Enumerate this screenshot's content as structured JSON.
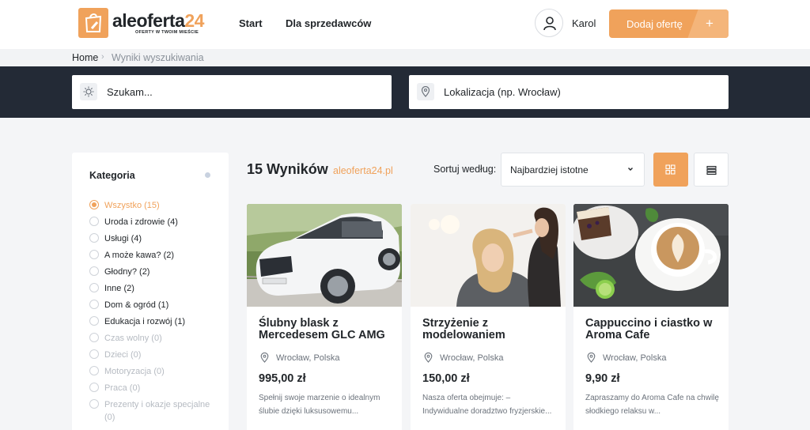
{
  "header": {
    "logo_text": "aleoferta",
    "logo_number": "24",
    "logo_tagline": "OFERTY W TWOIM MIEŚCIE",
    "nav": [
      "Start",
      "Dla sprzedawców"
    ],
    "user_name": "Karol",
    "add_button": "Dodaj ofertę",
    "add_icon": "+",
    "accent_color": "#f0a25b"
  },
  "breadcrumb": {
    "home": "Home",
    "separator": "›",
    "current": "Wyniki wyszukiwania"
  },
  "search": {
    "query_placeholder": "Szukam...",
    "location_placeholder": "Lokalizacja (np. Wrocław)"
  },
  "sidebar": {
    "title": "Kategoria",
    "categories": [
      {
        "label": "Wszystko (15)",
        "state": "active"
      },
      {
        "label": "Uroda i zdrowie (4)",
        "state": "normal"
      },
      {
        "label": "Usługi (4)",
        "state": "normal"
      },
      {
        "label": "A może kawa? (2)",
        "state": "normal"
      },
      {
        "label": "Głodny? (2)",
        "state": "normal"
      },
      {
        "label": "Inne (2)",
        "state": "normal"
      },
      {
        "label": "Dom & ogród (1)",
        "state": "normal"
      },
      {
        "label": "Edukacja i rozwój (1)",
        "state": "normal"
      },
      {
        "label": "Czas wolny (0)",
        "state": "disabled"
      },
      {
        "label": "Dzieci (0)",
        "state": "disabled"
      },
      {
        "label": "Motoryzacja (0)",
        "state": "disabled"
      },
      {
        "label": "Praca (0)",
        "state": "disabled"
      },
      {
        "label": "Prezenty i okazje specjalne (0)",
        "state": "disabled"
      }
    ]
  },
  "results": {
    "count_label": "15 Wyników",
    "domain": "aleoferta24.pl",
    "sort_label": "Sortuj według:",
    "sort_value": "Najbardziej istotne",
    "view_mode": "grid"
  },
  "cards": [
    {
      "title": "Ślubny blask z Mercedesem GLC AMG",
      "location": "Wrocław, Polska",
      "price": "995,00 zł",
      "description": "Spełnij swoje marzenie o idealnym ślubie dzięki luksusowemu...",
      "image": "white-mercedes-suv"
    },
    {
      "title": "Strzyżenie z modelowaniem",
      "location": "Wrocław, Polska",
      "price": "150,00 zł",
      "description": "Nasza oferta obejmuje: – Indywidualne doradztwo fryzjerskie...",
      "image": "hair-salon"
    },
    {
      "title": "Cappuccino i ciastko w Aroma Cafe",
      "location": "Wrocław, Polska",
      "price": "9,90 zł",
      "description": "Zapraszamy do Aroma Cafe na chwilę słodkiego relaksu w...",
      "image": "coffee-and-cake"
    }
  ]
}
